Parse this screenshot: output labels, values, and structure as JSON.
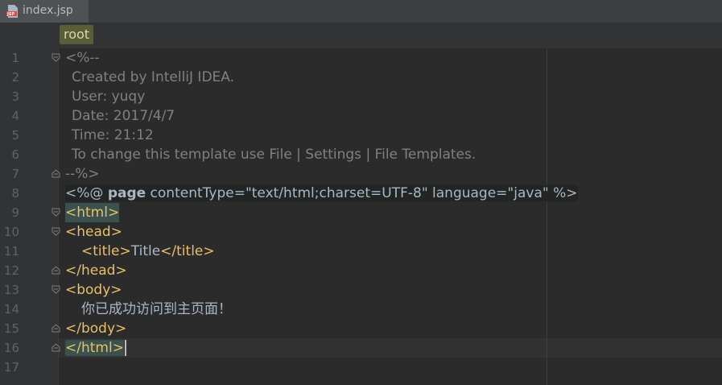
{
  "tab": {
    "filename": "index.jsp",
    "icon_label": "JSP"
  },
  "breadcrumb": {
    "item": "root"
  },
  "lines": [
    {
      "num": "1",
      "text": "<%--"
    },
    {
      "num": "2",
      "text": "Created by IntelliJ IDEA."
    },
    {
      "num": "3",
      "text": "User: yuqy"
    },
    {
      "num": "4",
      "text": "Date: 2017/4/7"
    },
    {
      "num": "5",
      "text": "Time: 21:12"
    },
    {
      "num": "6",
      "text": "To change this template use File | Settings | File Templates."
    },
    {
      "num": "7",
      "text": "--%>"
    },
    {
      "num": "8",
      "parts": [
        "<%@ ",
        "page",
        " contentType=\"",
        "text/html;charset=UTF-8",
        "\" language=\"",
        "java",
        "\" %>"
      ]
    },
    {
      "num": "9",
      "text": "<html>"
    },
    {
      "num": "10",
      "text": "<head>"
    },
    {
      "num": "11",
      "parts": [
        "<title>",
        "Title",
        "</title>"
      ]
    },
    {
      "num": "12",
      "text": "</head>"
    },
    {
      "num": "13",
      "text": "<body>"
    },
    {
      "num": "14",
      "text": "你已成功访问到主页面！"
    },
    {
      "num": "15",
      "text": "</body>"
    },
    {
      "num": "16",
      "text": "</html>"
    },
    {
      "num": "17",
      "text": ""
    }
  ],
  "colors": {
    "comment": "#808080",
    "tag": "#e8bf6a",
    "keyword": "#cc7832",
    "string": "#6a8759",
    "text": "#a9b7c6"
  }
}
